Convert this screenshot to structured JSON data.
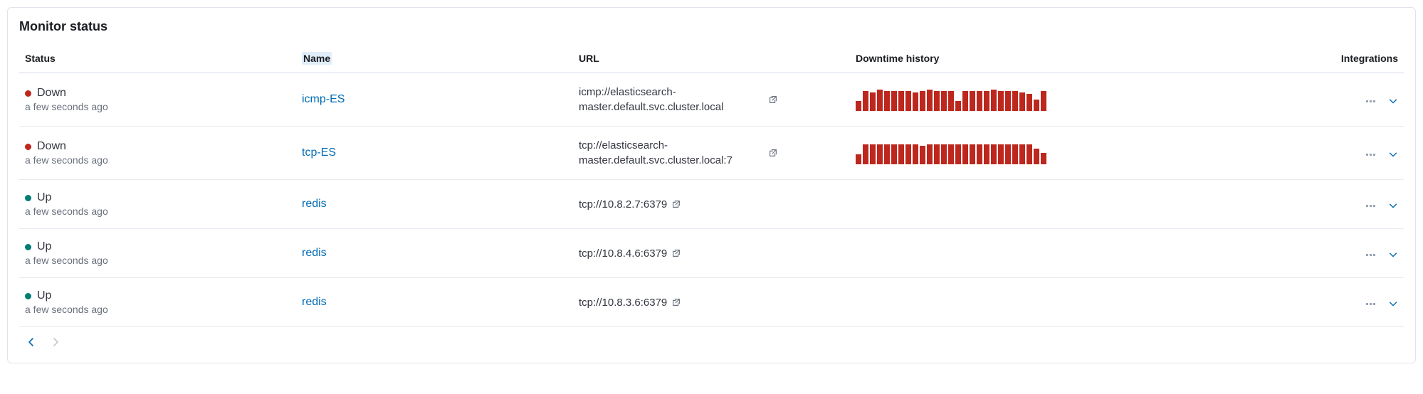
{
  "panel": {
    "title": "Monitor status"
  },
  "columns": {
    "status": "Status",
    "name": "Name",
    "url": "URL",
    "downtime": "Downtime history",
    "integrations": "Integrations"
  },
  "rows": [
    {
      "status": "Down",
      "status_kind": "down",
      "time": "a few seconds ago",
      "name": "icmp-ES",
      "url": "icmp://elasticsearch-master.default.svc.cluster.local",
      "downtime_bars": [
        14,
        28,
        26,
        30,
        28,
        28,
        28,
        28,
        26,
        28,
        30,
        28,
        28,
        28,
        14,
        28,
        28,
        28,
        28,
        30,
        28,
        28,
        28,
        26,
        24,
        16,
        28
      ]
    },
    {
      "status": "Down",
      "status_kind": "down",
      "time": "a few seconds ago",
      "name": "tcp-ES",
      "url": "tcp://elasticsearch-master.default.svc.cluster.local:7",
      "downtime_bars": [
        14,
        28,
        28,
        28,
        28,
        28,
        28,
        28,
        28,
        26,
        28,
        28,
        28,
        28,
        28,
        28,
        28,
        28,
        28,
        28,
        28,
        28,
        28,
        28,
        28,
        22,
        16
      ]
    },
    {
      "status": "Up",
      "status_kind": "up",
      "time": "a few seconds ago",
      "name": "redis",
      "url": "tcp://10.8.2.7:6379",
      "downtime_bars": []
    },
    {
      "status": "Up",
      "status_kind": "up",
      "time": "a few seconds ago",
      "name": "redis",
      "url": "tcp://10.8.4.6:6379",
      "downtime_bars": []
    },
    {
      "status": "Up",
      "status_kind": "up",
      "time": "a few seconds ago",
      "name": "redis",
      "url": "tcp://10.8.3.6:6379",
      "downtime_bars": []
    }
  ]
}
